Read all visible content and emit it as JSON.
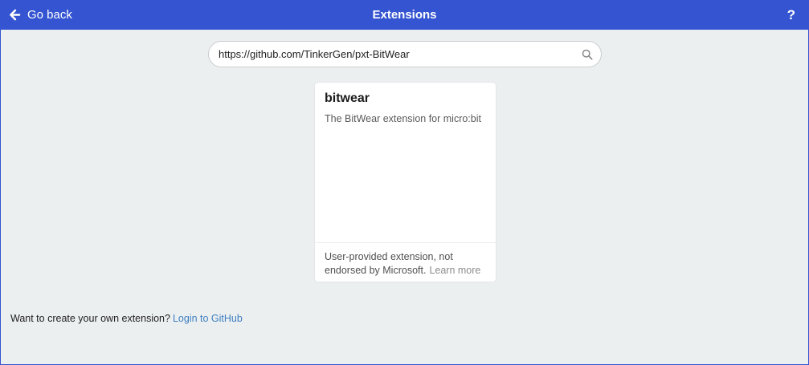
{
  "header": {
    "back_label": "Go back",
    "title": "Extensions",
    "help_label": "?"
  },
  "search": {
    "value": "https://github.com/TinkerGen/pxt-BitWear"
  },
  "results": [
    {
      "name": "bitwear",
      "description": "The BitWear extension for micro:bit",
      "note": "User-provided extension, not endorsed by Microsoft.",
      "learn_more": "Learn more"
    }
  ],
  "footer": {
    "prompt": "Want to create your own extension?",
    "link": "Login to GitHub"
  },
  "colors": {
    "header_bg": "#3454d1",
    "page_bg": "#eceff0",
    "link": "#3e7fc1"
  },
  "icons": {
    "back": "arrow-left-icon",
    "search": "search-icon"
  }
}
